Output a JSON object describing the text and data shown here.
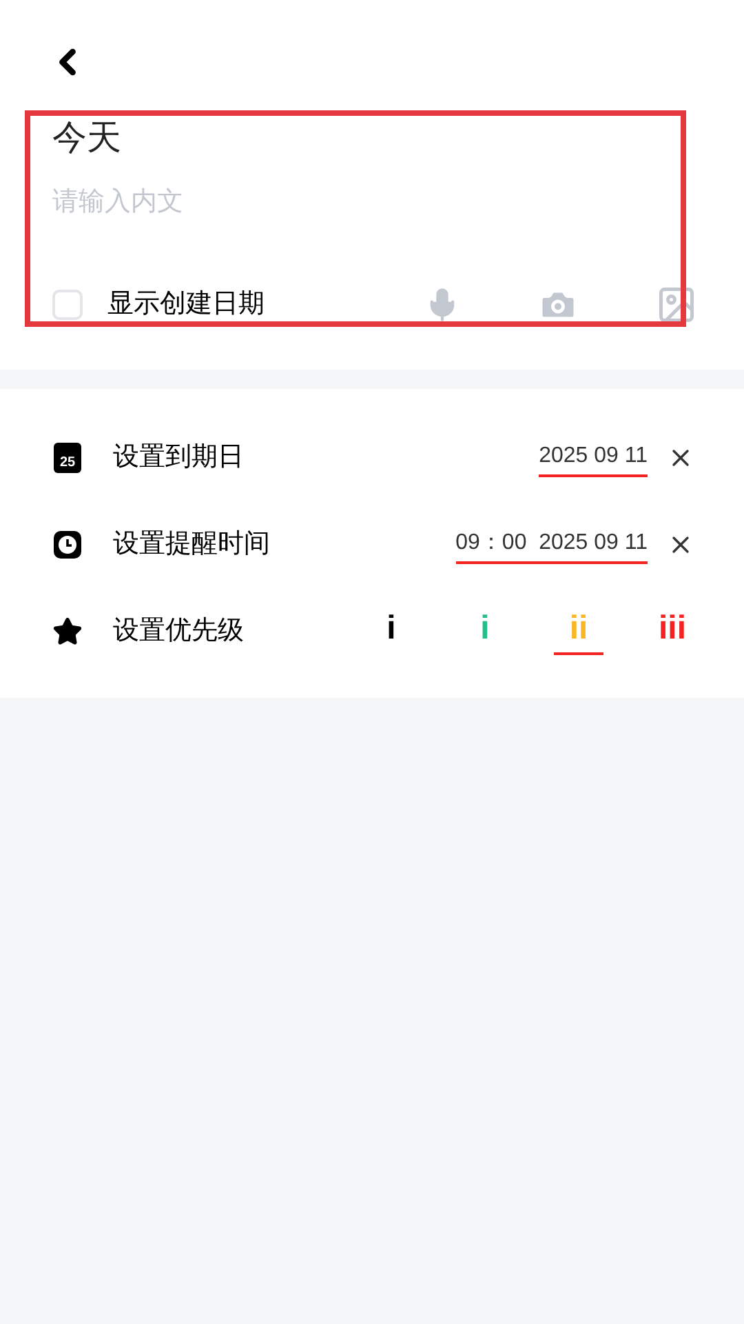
{
  "note": {
    "title": "今天",
    "placeholder": "请输入内文"
  },
  "show_created_date": {
    "label": "显示创建日期",
    "checked": false
  },
  "settings": [
    {
      "kind": "date",
      "label": "设置到期日",
      "icon_text": "25",
      "value": "2025 09 11"
    },
    {
      "kind": "reminder",
      "label": "设置提醒时间",
      "value": "09：00  2025 09 11"
    },
    {
      "kind": "priority",
      "label": "设置优先级",
      "options": [
        {
          "label": "i",
          "color": "#000000",
          "selected": false
        },
        {
          "label": "i",
          "color": "#22c088",
          "selected": false
        },
        {
          "label": "ii",
          "color": "#fbb624",
          "selected": true
        },
        {
          "label": "iii",
          "color": "#f52222",
          "selected": false
        }
      ]
    }
  ]
}
